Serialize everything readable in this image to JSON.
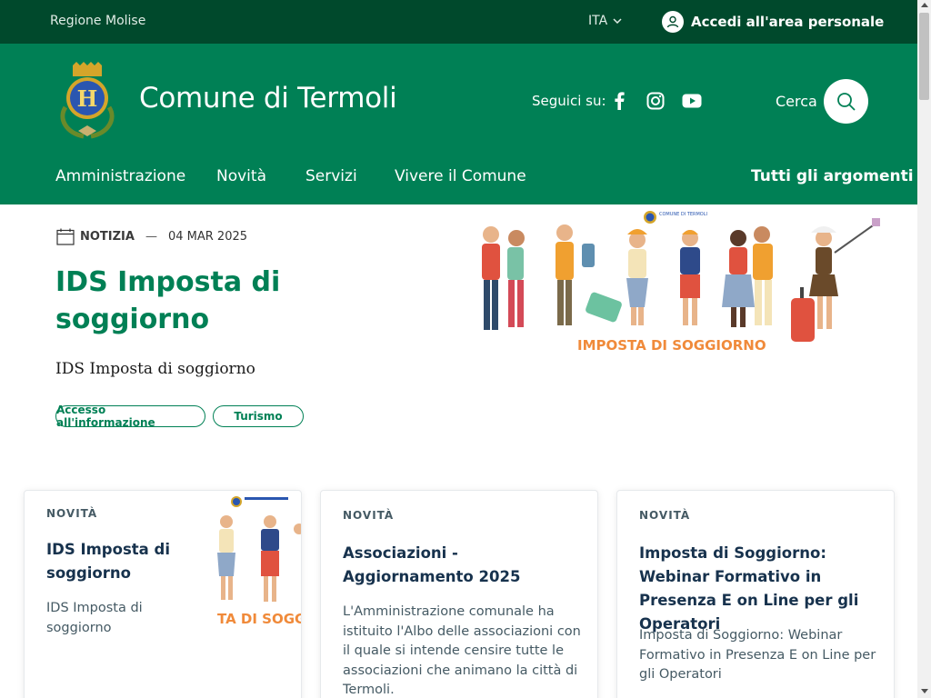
{
  "topbar": {
    "region": "Regione Molise",
    "lang": "ITA",
    "login": "Accedi all'area personale"
  },
  "header": {
    "title": "Comune di Termoli",
    "follow": "Seguici su:",
    "search": "Cerca",
    "nav": [
      "Amministrazione",
      "Novità",
      "Servizi",
      "Vivere il Comune"
    ],
    "nav_right": "Tutti gli argomenti"
  },
  "hero": {
    "category": "NOTIZIA",
    "date": "04 MAR 2025",
    "title": "IDS Imposta di soggiorno",
    "description": "IDS Imposta di soggiorno",
    "chips": [
      "Accesso all'informazione",
      "Turismo"
    ],
    "image_caption": "IMPOSTA DI SOGGIORNO",
    "image_badge": "COMUNE DI TERMOLI"
  },
  "cards": [
    {
      "tag": "NOVITÀ",
      "title": "IDS Imposta di soggiorno",
      "text": "IDS Imposta di soggiorno",
      "thumb_caption": "TA DI SOGG"
    },
    {
      "tag": "NOVITÀ",
      "title": "Associazioni - Aggiornamento 2025",
      "text": "L'Amministrazione comunale ha istituito l'Albo delle associazioni con il quale si intende censire tutte le associazioni che animano la città di Termoli."
    },
    {
      "tag": "NOVITÀ",
      "title": "Imposta di Soggiorno: Webinar Formativo in Presenza E on Line per gli Operatori",
      "text": "Imposta di Soggiorno: Webinar Formativo in Presenza E on Line per gli Operatori"
    }
  ],
  "colors": {
    "topbar": "#00492c",
    "header": "#008055",
    "accent": "#008055",
    "card_title": "#17324d"
  }
}
